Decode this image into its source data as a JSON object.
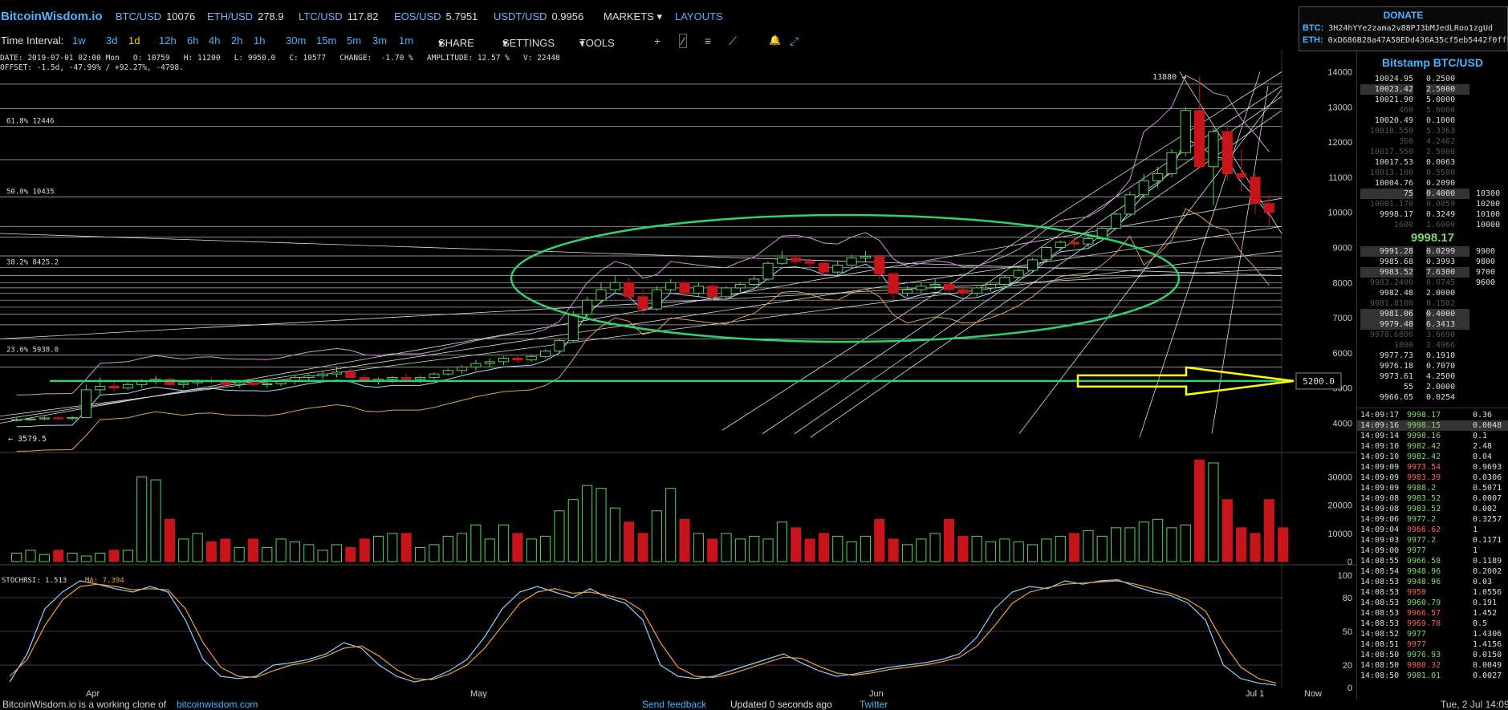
{
  "app_title": "BitcoinWisdom.io",
  "tickers": [
    {
      "sym": "BTC/USD",
      "val": "10076"
    },
    {
      "sym": "ETH/USD",
      "val": "278.9"
    },
    {
      "sym": "LTC/USD",
      "val": "117.82"
    },
    {
      "sym": "EOS/USD",
      "val": "5.7951"
    },
    {
      "sym": "USDT/USD",
      "val": "0.9956"
    }
  ],
  "menu": {
    "markets": "MARKETS",
    "layouts": "LAYOUTS"
  },
  "toolbar": {
    "label": "Time Interval:",
    "intervals": [
      "1w",
      "3d",
      "1d",
      "12h",
      "6h",
      "4h",
      "2h",
      "1h",
      "30m",
      "15m",
      "5m",
      "3m",
      "1m"
    ],
    "selected_interval": "1d",
    "share": "SHARE",
    "settings": "SETTINGS",
    "tools": "TOOLS",
    "tool_glyphs": [
      "+",
      "⁄",
      "≡",
      "⟋",
      "🔔",
      "⤢"
    ]
  },
  "info": {
    "line1": "DATE: 2019-07-01 02:00 Mon   O: 10759   H: 11200   L: 9950.0   C: 10577   CHANGE:  -1.70 %   AMPLITUDE: 12.57 %   V: 22448",
    "line2": "OFFSET: -1.5d, -47.99% / +92.27%, -4798."
  },
  "donate": {
    "title": "DONATE",
    "btc_label": "BTC:",
    "btc_addr": "3H24hYYe2zama2v88PJ3bMJedLRoo1zgUd",
    "eth_label": "ETH:",
    "eth_addr": "0xD686B28a47A58EDd436A35cf5eb5442f0ff6"
  },
  "market_title": "Bitstamp BTC/USD",
  "last_price": "9998.17",
  "chart_data": {
    "type": "candlestick",
    "price_axis_ticks": [
      "14000",
      "13000",
      "12000",
      "11000",
      "10000",
      "9000",
      "8000",
      "7000",
      "6000",
      "5000",
      "4000"
    ],
    "price_range": [
      3600,
      14400
    ],
    "volume_axis_ticks": [
      "30000",
      "20000",
      "10000",
      "0"
    ],
    "volume_range": [
      0,
      37000
    ],
    "rsi_axis_ticks": [
      "100",
      "80",
      "50",
      "20",
      "0"
    ],
    "x_labels": [
      "Apr",
      "May",
      "Jun",
      "Jul 1"
    ],
    "now_label": "Now",
    "fib_labels": [
      {
        "text": "61.8% 12446",
        "price": 12446
      },
      {
        "text": "50.0% 10435",
        "price": 10435
      },
      {
        "text": "38.2% 8425.2",
        "price": 8425.2
      },
      {
        "text": "23.6% 5938.0",
        "price": 5938.0
      }
    ],
    "low_label": "3579.5",
    "high_label": "13880",
    "marker_label": "5200.0",
    "marker_price": 5200,
    "stoch_label": "STOCHRSI: 1.513",
    "ma_label": "MA: 7.394",
    "candles_ohlc": [
      [
        4100,
        4150,
        4050,
        4100
      ],
      [
        4100,
        4160,
        4060,
        4120
      ],
      [
        4120,
        4200,
        4080,
        4150
      ],
      [
        4150,
        4200,
        4100,
        4130
      ],
      [
        4130,
        4200,
        4080,
        4160
      ],
      [
        4160,
        5100,
        4150,
        4950
      ],
      [
        4950,
        5300,
        4800,
        5050
      ],
      [
        5050,
        5200,
        4900,
        5000
      ],
      [
        5000,
        5150,
        4950,
        5100
      ],
      [
        5100,
        5250,
        5000,
        5200
      ],
      [
        5200,
        5350,
        5100,
        5250
      ],
      [
        5250,
        5300,
        5050,
        5100
      ],
      [
        5100,
        5220,
        5000,
        5150
      ],
      [
        5150,
        5250,
        5050,
        5200
      ],
      [
        5200,
        5300,
        5100,
        5180
      ],
      [
        5180,
        5280,
        5050,
        5100
      ],
      [
        5100,
        5200,
        5000,
        5150
      ],
      [
        5150,
        5250,
        5050,
        5100
      ],
      [
        5100,
        5200,
        5000,
        5120
      ],
      [
        5120,
        5250,
        5050,
        5200
      ],
      [
        5200,
        5350,
        5100,
        5300
      ],
      [
        5300,
        5400,
        5200,
        5350
      ],
      [
        5350,
        5500,
        5250,
        5400
      ],
      [
        5400,
        5600,
        5300,
        5450
      ],
      [
        5450,
        5600,
        5300,
        5300
      ],
      [
        5300,
        5400,
        5150,
        5200
      ],
      [
        5200,
        5300,
        5100,
        5250
      ],
      [
        5250,
        5350,
        5150,
        5300
      ],
      [
        5300,
        5400,
        5200,
        5250
      ],
      [
        5250,
        5350,
        5150,
        5300
      ],
      [
        5300,
        5450,
        5250,
        5400
      ],
      [
        5400,
        5550,
        5350,
        5500
      ],
      [
        5500,
        5650,
        5400,
        5600
      ],
      [
        5600,
        5800,
        5500,
        5700
      ],
      [
        5700,
        5850,
        5600,
        5750
      ],
      [
        5750,
        5900,
        5650,
        5850
      ],
      [
        5850,
        5950,
        5700,
        5800
      ],
      [
        5800,
        5950,
        5750,
        5900
      ],
      [
        5900,
        6100,
        5850,
        6050
      ],
      [
        6050,
        6400,
        6000,
        6350
      ],
      [
        6350,
        7200,
        6300,
        7100
      ],
      [
        7100,
        7600,
        7000,
        7500
      ],
      [
        7500,
        8000,
        7400,
        7800
      ],
      [
        7800,
        8200,
        7700,
        8000
      ],
      [
        8000,
        8150,
        7500,
        7600
      ],
      [
        7600,
        7800,
        7100,
        7250
      ],
      [
        7250,
        7900,
        7200,
        7800
      ],
      [
        7800,
        8100,
        7700,
        8000
      ],
      [
        8000,
        8050,
        7600,
        7700
      ],
      [
        7700,
        8000,
        7600,
        7900
      ],
      [
        7900,
        7950,
        7500,
        7600
      ],
      [
        7600,
        7900,
        7500,
        7850
      ],
      [
        7850,
        8000,
        7700,
        7950
      ],
      [
        7950,
        8200,
        7900,
        8100
      ],
      [
        8100,
        8600,
        8050,
        8550
      ],
      [
        8550,
        8900,
        8500,
        8700
      ],
      [
        8700,
        8800,
        8500,
        8600
      ],
      [
        8600,
        8700,
        8400,
        8550
      ],
      [
        8550,
        8650,
        8200,
        8300
      ],
      [
        8300,
        8600,
        8200,
        8500
      ],
      [
        8500,
        8800,
        8400,
        8700
      ],
      [
        8700,
        8900,
        8600,
        8750
      ],
      [
        8750,
        8800,
        8100,
        8250
      ],
      [
        8250,
        8300,
        7500,
        7700
      ],
      [
        7700,
        7900,
        7600,
        7800
      ],
      [
        7800,
        8000,
        7700,
        7900
      ],
      [
        7900,
        8100,
        7800,
        7950
      ],
      [
        7950,
        8000,
        7700,
        7800
      ],
      [
        7800,
        7950,
        7600,
        7700
      ],
      [
        7700,
        7900,
        7600,
        7850
      ],
      [
        7850,
        8000,
        7750,
        7950
      ],
      [
        7950,
        8200,
        7900,
        8150
      ],
      [
        8150,
        8400,
        8100,
        8350
      ],
      [
        8350,
        8700,
        8300,
        8650
      ],
      [
        8650,
        9050,
        8600,
        9000
      ],
      [
        9000,
        9200,
        8900,
        9150
      ],
      [
        9150,
        9300,
        9000,
        9100
      ],
      [
        9100,
        9400,
        9000,
        9250
      ],
      [
        9250,
        9600,
        9200,
        9550
      ],
      [
        9550,
        10000,
        9500,
        9950
      ],
      [
        9950,
        10600,
        9900,
        10500
      ],
      [
        10500,
        11100,
        10400,
        10900
      ],
      [
        10900,
        11300,
        10700,
        11100
      ],
      [
        11100,
        11800,
        11000,
        11700
      ],
      [
        11700,
        13000,
        11600,
        12900
      ],
      [
        12900,
        13880,
        12800,
        11300
      ],
      [
        11300,
        12400,
        10200,
        12300
      ],
      [
        12300,
        12500,
        10900,
        11100
      ],
      [
        11100,
        11800,
        10600,
        11000
      ],
      [
        11000,
        11100,
        9950,
        10250
      ],
      [
        10250,
        10500,
        9600,
        10000
      ]
    ],
    "volumes": [
      3000,
      4000,
      2500,
      4000,
      3000,
      2000,
      3000,
      4000,
      4000,
      30000,
      29000,
      15000,
      8000,
      10000,
      7000,
      8000,
      5000,
      8000,
      5000,
      8000,
      7000,
      6000,
      4000,
      6000,
      5000,
      8000,
      9000,
      10000,
      10000,
      5000,
      6000,
      9000,
      10000,
      13000,
      8000,
      13000,
      10000,
      8000,
      9000,
      18000,
      22000,
      27000,
      26000,
      19000,
      14000,
      10000,
      18000,
      26000,
      15000,
      10000,
      8000,
      10000,
      8000,
      9000,
      8000,
      14000,
      12000,
      8000,
      10000,
      9000,
      7000,
      9000,
      15000,
      8000,
      6000,
      8000,
      10000,
      15000,
      9000,
      9000,
      7000,
      8000,
      7000,
      6000,
      8000,
      9000,
      10000,
      11000,
      9000,
      12000,
      12000,
      14000,
      15000,
      12000,
      13000,
      36000,
      35000,
      22000,
      12000,
      10000,
      22000,
      12000
    ],
    "stoch_k": [
      5,
      30,
      70,
      85,
      95,
      92,
      88,
      85,
      90,
      85,
      60,
      25,
      10,
      8,
      10,
      20,
      22,
      25,
      30,
      40,
      35,
      20,
      10,
      5,
      8,
      15,
      25,
      45,
      70,
      85,
      90,
      85,
      80,
      88,
      80,
      75,
      60,
      20,
      10,
      8,
      10,
      15,
      20,
      25,
      30,
      22,
      15,
      10,
      12,
      15,
      18,
      20,
      22,
      25,
      30,
      45,
      70,
      85,
      90,
      88,
      95,
      92,
      95,
      96,
      90,
      85,
      82,
      75,
      60,
      20,
      8,
      4,
      2
    ],
    "stoch_d": [
      10,
      25,
      55,
      78,
      90,
      92,
      90,
      87,
      88,
      87,
      70,
      40,
      18,
      10,
      9,
      15,
      20,
      23,
      28,
      35,
      37,
      28,
      16,
      8,
      7,
      12,
      20,
      35,
      55,
      75,
      85,
      88,
      84,
      85,
      82,
      78,
      68,
      40,
      18,
      10,
      9,
      12,
      17,
      22,
      27,
      26,
      19,
      13,
      11,
      13,
      16,
      18,
      20,
      23,
      27,
      37,
      55,
      75,
      85,
      89,
      92,
      93,
      94,
      95,
      92,
      88,
      84,
      78,
      68,
      40,
      18,
      8,
      4
    ]
  },
  "orderbook": {
    "asks": [
      {
        "p": "10024.95",
        "a": "0.2500",
        "sum": "",
        "cls": "white"
      },
      {
        "p": "10023.42",
        "a": "2.5000",
        "sum": "",
        "cls": "hl"
      },
      {
        "p": "10021.90",
        "a": "5.0000",
        "sum": "",
        "cls": "white"
      },
      {
        "p": "460",
        "a": "5.0000",
        "sum": "",
        "cls": "dim"
      },
      {
        "p": "10020.49",
        "a": "0.1000",
        "sum": "",
        "cls": "white"
      },
      {
        "p": "10018.550",
        "a": "5.3363",
        "sum": "",
        "cls": "dim"
      },
      {
        "p": "360",
        "a": "4.2462",
        "sum": "",
        "cls": "dim"
      },
      {
        "p": "10017.550",
        "a": "2.5000",
        "sum": "",
        "cls": "dim"
      },
      {
        "p": "10017.53",
        "a": "0.0063",
        "sum": "",
        "cls": "white"
      },
      {
        "p": "10013.100",
        "a": "0.5500",
        "sum": "",
        "cls": "dim"
      },
      {
        "p": "10004.76",
        "a": "0.2090",
        "sum": "",
        "cls": "white"
      },
      {
        "p": "75",
        "a": "0.4000",
        "sum": "10300",
        "cls": "hl"
      },
      {
        "p": "10001.170",
        "a": "0.0859",
        "sum": "10200",
        "cls": "dim"
      },
      {
        "p": "9998.17",
        "a": "0.3249",
        "sum": "10100",
        "cls": "white"
      },
      {
        "p": "1600",
        "a": "1.6000",
        "sum": "10000",
        "cls": "dim"
      }
    ],
    "bids": [
      {
        "p": "9991.28",
        "a": "0.0299",
        "sum": "9900",
        "cls": "hl"
      },
      {
        "p": "9985.68",
        "a": "0.3993",
        "sum": "9800",
        "cls": "white"
      },
      {
        "p": "9983.52",
        "a": "7.6300",
        "sum": "9700",
        "cls": "hl"
      },
      {
        "p": "9983.2400",
        "a": "0.0745",
        "sum": "9600",
        "cls": "dim"
      },
      {
        "p": "9982.48",
        "a": "2.0000",
        "sum": "",
        "cls": "white"
      },
      {
        "p": "9981.8100",
        "a": "0.1502",
        "sum": "",
        "cls": "dim"
      },
      {
        "p": "9981.06",
        "a": "0.4000",
        "sum": "",
        "cls": "hl"
      },
      {
        "p": "9979.48",
        "a": "6.3413",
        "sum": "",
        "cls": "hl"
      },
      {
        "p": "9978.6800",
        "a": "3.6690",
        "sum": "",
        "cls": "dim"
      },
      {
        "p": "1800",
        "a": "2.4966",
        "sum": "",
        "cls": "dim"
      },
      {
        "p": "9977.73",
        "a": "0.1910",
        "sum": "",
        "cls": "white"
      },
      {
        "p": "9976.18",
        "a": "0.7070",
        "sum": "",
        "cls": "white"
      },
      {
        "p": "9973.61",
        "a": "4.2500",
        "sum": "",
        "cls": "white"
      },
      {
        "p": "55",
        "a": "2.0000",
        "sum": "",
        "cls": "white"
      },
      {
        "p": "9966.65",
        "a": "0.0254",
        "sum": "",
        "cls": "white"
      }
    ]
  },
  "trades": [
    {
      "t": "14:09:17",
      "p": "9998.17",
      "a": "0.36",
      "c": "g"
    },
    {
      "t": "14:09:16",
      "p": "9998.15",
      "a": "0.0048",
      "c": "g hl"
    },
    {
      "t": "14:09:14",
      "p": "9998.16",
      "a": "0.1",
      "c": "g"
    },
    {
      "t": "14:09:10",
      "p": "9982.42",
      "a": "2.48",
      "c": "g"
    },
    {
      "t": "14:09:10",
      "p": "9982.42",
      "a": "0.04",
      "c": "g"
    },
    {
      "t": "14:09:09",
      "p": "9973.54",
      "a": "0.9693",
      "c": "r"
    },
    {
      "t": "14:09:09",
      "p": "9983.39",
      "a": "0.0306",
      "c": "r"
    },
    {
      "t": "14:09:09",
      "p": "9988.2",
      "a": "0.5071",
      "c": "g"
    },
    {
      "t": "14:09:08",
      "p": "9983.52",
      "a": "0.0007",
      "c": "g"
    },
    {
      "t": "14:09:08",
      "p": "9983.52",
      "a": "0.002",
      "c": "g"
    },
    {
      "t": "14:09:06",
      "p": "9977.2",
      "a": "0.3257",
      "c": "g"
    },
    {
      "t": "14:09:04",
      "p": "9966.62",
      "a": "1",
      "c": "r"
    },
    {
      "t": "14:09:03",
      "p": "9977.2",
      "a": "0.1171",
      "c": "g"
    },
    {
      "t": "14:09:00",
      "p": "9977",
      "a": "1",
      "c": "g"
    },
    {
      "t": "14:08:55",
      "p": "9966.58",
      "a": "0.1189",
      "c": "g"
    },
    {
      "t": "14:08:54",
      "p": "9948.96",
      "a": "0.2002",
      "c": "g"
    },
    {
      "t": "14:08:53",
      "p": "9948.96",
      "a": "0.03",
      "c": "g"
    },
    {
      "t": "14:08:53",
      "p": "9950",
      "a": "1.0556",
      "c": "r"
    },
    {
      "t": "14:08:53",
      "p": "9960.79",
      "a": "0.191",
      "c": "g"
    },
    {
      "t": "14:08:53",
      "p": "9966.57",
      "a": "1.452",
      "c": "r"
    },
    {
      "t": "14:08:53",
      "p": "9969.78",
      "a": "0.5",
      "c": "r"
    },
    {
      "t": "14:08:52",
      "p": "9977",
      "a": "1.4306",
      "c": "g"
    },
    {
      "t": "14:08:51",
      "p": "9977",
      "a": "1.4156",
      "c": "r"
    },
    {
      "t": "14:08:50",
      "p": "9976.93",
      "a": "0.0150",
      "c": "g"
    },
    {
      "t": "14:08:50",
      "p": "9980.32",
      "a": "0.0049",
      "c": "r"
    },
    {
      "t": "14:08:50",
      "p": "9981.01",
      "a": "0.0027",
      "c": "g"
    }
  ],
  "footer": {
    "clone_text": "BitcoinWisdom.io is a working clone of",
    "clone_link": "bitcoinwisdom.com",
    "feedback": "Send feedback",
    "updated": "Updated 0 seconds ago",
    "twitter": "Twitter",
    "datetime": "Tue, 2 Jul 14:09"
  },
  "colors": {
    "up": "#59d45a",
    "down": "#c8151b",
    "accent": "#4ab3ff",
    "ellipse": "#2fd36a",
    "arrow": "#ffff00"
  }
}
